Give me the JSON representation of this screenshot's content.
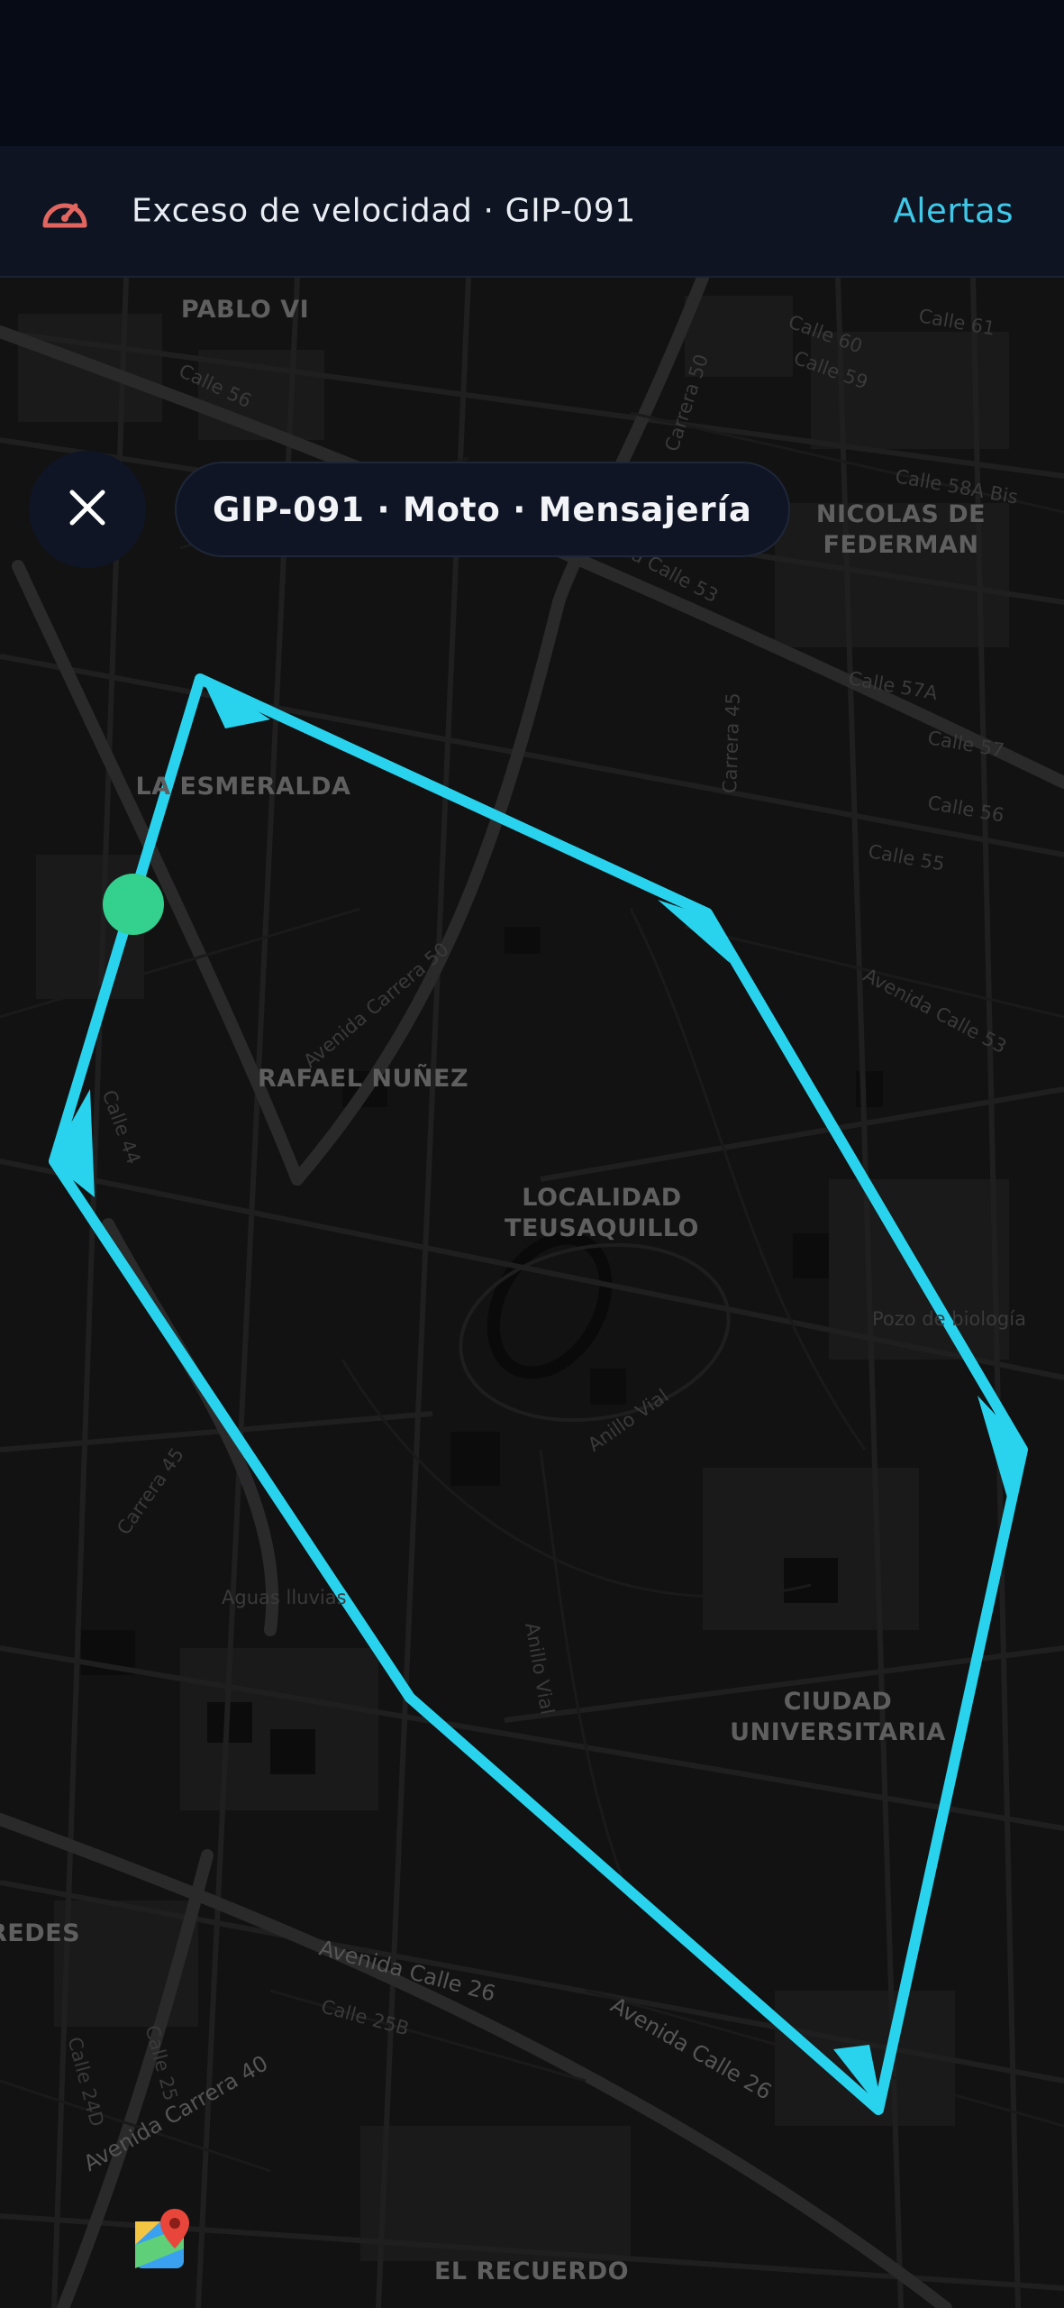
{
  "banner": {
    "icon": "speedometer-icon",
    "text": "Exceso de velocidad · GIP-091",
    "action_label": "Alertas",
    "icon_color": "#e2665f",
    "action_color": "#3fc8e8"
  },
  "vehicle_chip": {
    "label": "GIP-091 · Moto · Mensajería"
  },
  "close_button": {
    "icon": "close-icon"
  },
  "map": {
    "route_color": "#29d3ee",
    "vehicle_marker_color": "#34d08e",
    "district_labels": {
      "pablo_vi": "PABLO VI",
      "nicolas_federman": "NICOLAS DE\nFEDERMAN",
      "la_esmeralda": "LA ESMERALDA",
      "rafael_nunez": "RAFAEL NUÑEZ",
      "teusaquillo": "LOCALIDAD\nTEUSAQUILLO",
      "ciudad_universitaria": "CIUDAD\nUNIVERSITARIA",
      "redes": "REDES",
      "el_recuerdo": "EL RECUERDO"
    },
    "street_labels": {
      "av_calle_53": "Avenida Calle 53",
      "av_calle_53_right": "Avenida Calle 53",
      "av_carrera_50": "Avenida Carrera 50",
      "carrera_50": "Carrera 50",
      "carrera_45": "Carrera 45",
      "carrera_45_left": "Carrera 45",
      "calle_44": "Calle 44",
      "calle_57a": "Calle 57A",
      "calle_57": "Calle 57",
      "calle_56": "Calle 56",
      "calle_55": "Calle 55",
      "calle_58a": "Calle 58A Bis",
      "calle_60": "Calle 60",
      "calle_61": "Calle 61",
      "calle_59": "Calle 59",
      "calle_56_top": "Calle 56",
      "anillo_vial": "Anillo Vial",
      "anillo_vial_2": "Anillo Vial",
      "pozo": "Pozo de biología",
      "aguas_lluvias": "Aguas lluvias",
      "av_calle_26": "Avenida Calle 26",
      "av_calle_26_b": "Avenida Calle 26",
      "av_carrera_40": "Avenida Carrera 40",
      "calle_25b": "Calle 25B",
      "calle_25": "Calle 25",
      "calle_24d": "Calle 24D"
    },
    "maps_logo": "maps-app-icon"
  }
}
